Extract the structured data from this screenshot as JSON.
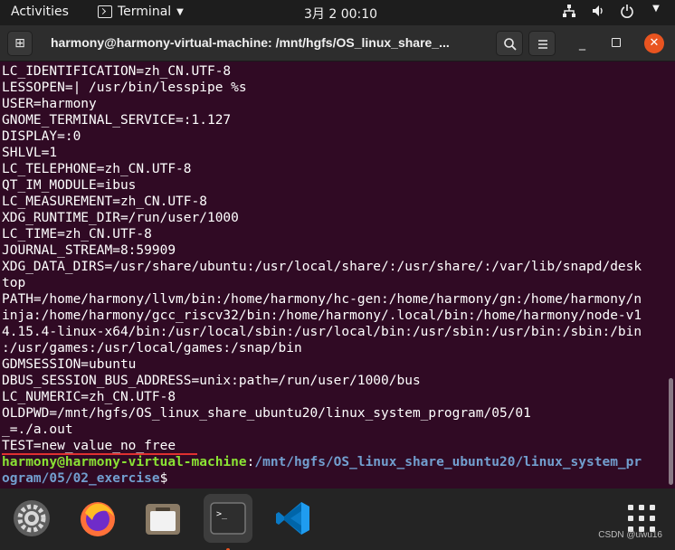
{
  "topbar": {
    "activities": "Activities",
    "app_name": "Terminal",
    "clock": "3月 2  00:10",
    "status_icons": [
      "network-icon",
      "volume-icon",
      "power-icon"
    ]
  },
  "window": {
    "title": "harmony@harmony-virtual-machine: /mnt/hgfs/OS_linux_share_..."
  },
  "terminal": {
    "lines": [
      "LC_IDENTIFICATION=zh_CN.UTF-8",
      "LESSOPEN=| /usr/bin/lesspipe %s",
      "USER=harmony",
      "GNOME_TERMINAL_SERVICE=:1.127",
      "DISPLAY=:0",
      "SHLVL=1",
      "LC_TELEPHONE=zh_CN.UTF-8",
      "QT_IM_MODULE=ibus",
      "LC_MEASUREMENT=zh_CN.UTF-8",
      "XDG_RUNTIME_DIR=/run/user/1000",
      "LC_TIME=zh_CN.UTF-8",
      "JOURNAL_STREAM=8:59909",
      "XDG_DATA_DIRS=/usr/share/ubuntu:/usr/local/share/:/usr/share/:/var/lib/snapd/desk",
      "top",
      "PATH=/home/harmony/llvm/bin:/home/harmony/hc-gen:/home/harmony/gn:/home/harmony/n",
      "inja:/home/harmony/gcc_riscv32/bin:/home/harmony/.local/bin:/home/harmony/node-v1",
      "4.15.4-linux-x64/bin:/usr/local/sbin:/usr/local/bin:/usr/sbin:/usr/bin:/sbin:/bin",
      ":/usr/games:/usr/local/games:/snap/bin",
      "GDMSESSION=ubuntu",
      "DBUS_SESSION_BUS_ADDRESS=unix:path=/run/user/1000/bus",
      "LC_NUMERIC=zh_CN.UTF-8",
      "OLDPWD=/mnt/hgfs/OS_linux_share_ubuntu20/linux_system_program/05/01",
      "_=./a.out",
      "TEST=new_value_no_free"
    ],
    "prompt_user": "harmony@harmony-virtual-machine",
    "prompt_sep": ":",
    "prompt_path_1": "/mnt/hgfs/OS_linux_share_ubuntu20/linux_system_pr",
    "prompt_path_2": "ogram/05/02_exercise",
    "prompt_symbol": "$"
  },
  "dock": {
    "items": [
      "settings-app",
      "firefox",
      "files",
      "terminal",
      "vscode",
      "show-applications"
    ],
    "watermark": "CSDN @uwu16"
  }
}
